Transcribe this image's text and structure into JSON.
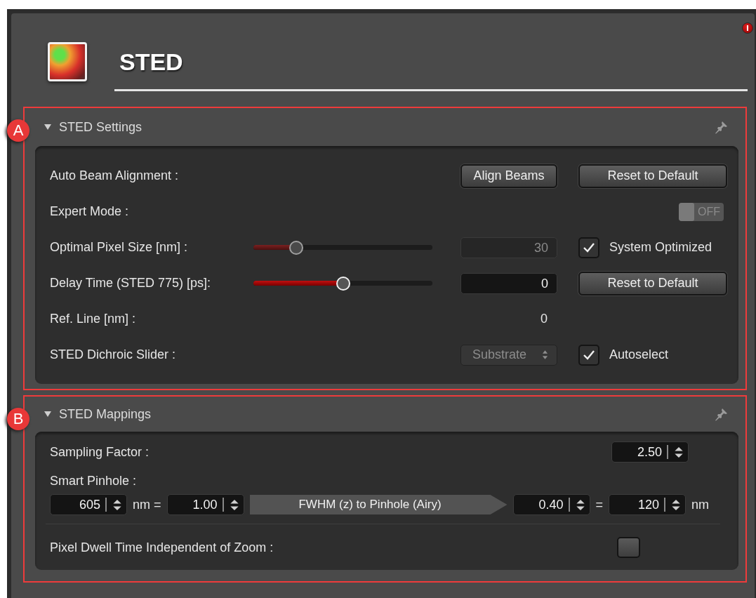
{
  "title": "STED",
  "sections": [
    {
      "marker": "A",
      "title": "STED Settings",
      "expanded": true,
      "rows": [
        {
          "label": "Auto Beam Alignment :",
          "middle": {
            "kind": "button",
            "label": "Align Beams"
          },
          "right": {
            "kind": "button",
            "label": "Reset to Default"
          }
        },
        {
          "label": "Expert Mode :",
          "right": {
            "kind": "toggle",
            "on": false,
            "disabled": true,
            "label": "OFF"
          }
        },
        {
          "label": "Optimal Pixel Size [nm] :",
          "slider": {
            "level": 0.24,
            "disabled": true
          },
          "middle": {
            "kind": "field",
            "value": "30",
            "disabled": true
          },
          "right": {
            "kind": "checkbox",
            "checked": true,
            "label": "System Optimized"
          }
        },
        {
          "label": "Delay Time (STED 775) [ps]:",
          "slider": {
            "level": 0.5,
            "disabled": false
          },
          "middle": {
            "kind": "field",
            "value": "0",
            "disabled": false
          },
          "right": {
            "kind": "button",
            "label": "Reset to Default"
          }
        },
        {
          "label": "Ref. Line [nm] :",
          "middle": {
            "kind": "text",
            "value": "0"
          }
        },
        {
          "label": "STED Dichroic Slider :",
          "middle": {
            "kind": "select",
            "value": "Substrate",
            "disabled": true
          },
          "right": {
            "kind": "checkbox",
            "checked": true,
            "label": "Autoselect"
          }
        }
      ]
    },
    {
      "marker": "B",
      "title": "STED Mappings",
      "expanded": true,
      "sampling": {
        "label": "Sampling Factor :",
        "value": "2.50"
      },
      "pinhole": {
        "label": "Smart Pinhole :",
        "items": [
          {
            "kind": "spinner",
            "value": "605"
          },
          {
            "kind": "text",
            "value": "nm ="
          },
          {
            "kind": "spinner",
            "value": "1.00"
          },
          {
            "kind": "arrow",
            "label": "FWHM (z) to Pinhole (Airy)"
          },
          {
            "kind": "spinner",
            "value": "0.40"
          },
          {
            "kind": "text",
            "value": "="
          },
          {
            "kind": "spinner",
            "value": "120"
          },
          {
            "kind": "text",
            "value": "nm"
          }
        ]
      },
      "dwell": {
        "label": "Pixel Dwell Time Independent of Zoom :",
        "checked": false
      }
    }
  ]
}
